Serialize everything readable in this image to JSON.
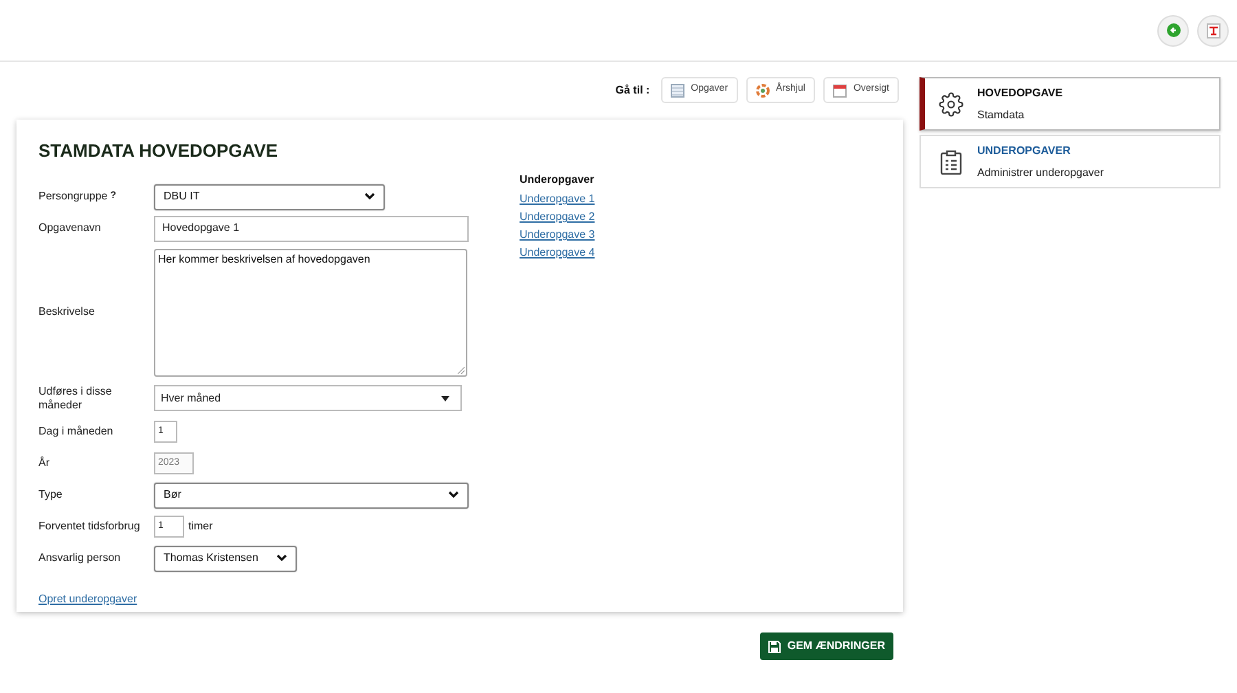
{
  "goto": {
    "label": "Gå til :",
    "buttons": [
      {
        "kind": "list",
        "label": "Opgaver"
      },
      {
        "kind": "wheel",
        "label": "Årshjul"
      },
      {
        "kind": "calendar",
        "label": "Oversigt"
      }
    ]
  },
  "form": {
    "title": "STAMDATA HOVEDOPGAVE",
    "fields": [
      {
        "kind": "select",
        "label": "Persongruppe",
        "help": "?",
        "value": "DBU IT"
      },
      {
        "kind": "input",
        "label": "Opgavenavn",
        "value": "Hovedopgave 1"
      },
      {
        "kind": "textarea",
        "label": "Beskrivelse",
        "value": "Her kommer beskrivelsen af hovedopgaven"
      },
      {
        "kind": "dropdown",
        "label": "Udføres i disse måneder",
        "value": "Hver måned"
      },
      {
        "kind": "input",
        "label": "Dag i måneden",
        "value": "1"
      },
      {
        "kind": "input",
        "label": "År",
        "value": "2023",
        "disabled": true
      },
      {
        "kind": "select",
        "label": "Type",
        "value": "Bør"
      },
      {
        "kind": "input",
        "label": "Forventet tidsforbrug",
        "value": "1",
        "unit": "timer"
      },
      {
        "kind": "select",
        "label": "Ansvarlig person",
        "value": "Thomas Kristensen"
      }
    ],
    "link": "Opret underopgaver",
    "subtasks": {
      "title": "Underopgaver",
      "links": [
        "Underopgave 1",
        "Underopgave 2",
        "Underopgave 3",
        "Underopgave 4"
      ]
    }
  },
  "save_button": "GEM ÆNDRINGER",
  "side_menu": [
    {
      "kind": "gear",
      "title": "HOVEDOPGAVE",
      "subtitle": "Stamdata",
      "selected": true
    },
    {
      "kind": "clipboard",
      "title": "UNDEROPGAVER",
      "subtitle": "Administrer underopgaver",
      "selected": false
    }
  ]
}
